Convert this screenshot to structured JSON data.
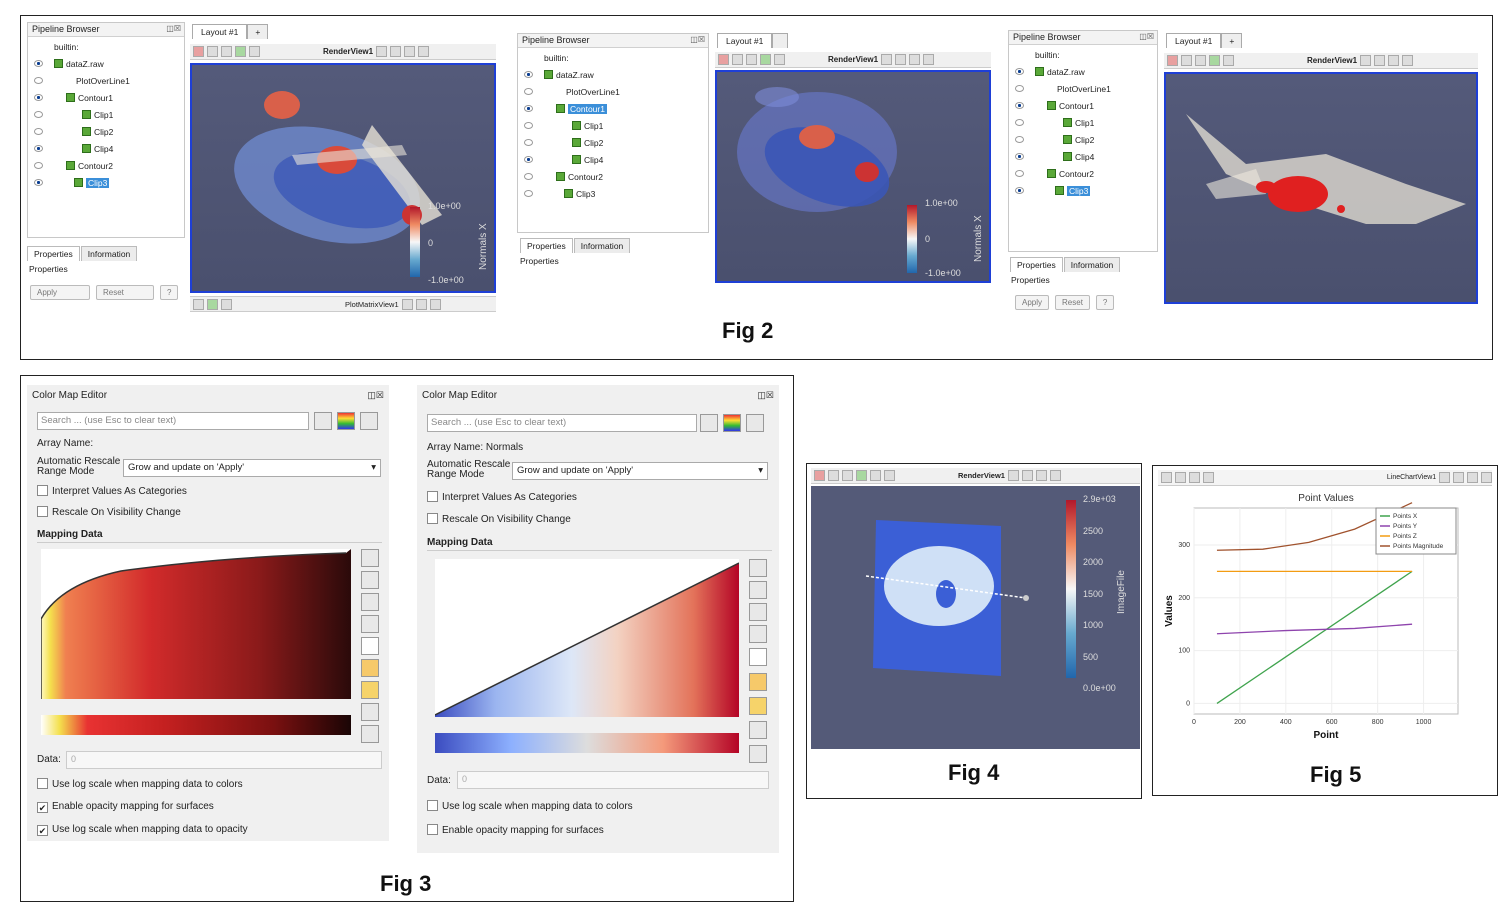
{
  "fig2": {
    "caption": "Fig 2",
    "panels": [
      {
        "pipeline_title": "Pipeline Browser",
        "tree": [
          "builtin:",
          "dataZ.raw",
          "PlotOverLine1",
          "Contour1",
          "Clip1",
          "Clip2",
          "Clip4",
          "Contour2",
          "Clip3"
        ],
        "tabs": [
          "Properties",
          "Information"
        ],
        "properties_label": "Properties",
        "apply": "Apply",
        "reset": "Reset",
        "help": "?",
        "layout_tab": "Layout #1",
        "plus": "+",
        "view_name": "RenderView1",
        "bottom_view": "PlotMatrixView1",
        "cbar_top": "1.0e+00",
        "cbar_mid": "0",
        "cbar_bot": "-1.0e+00",
        "cbar_title": "Normals X"
      },
      {
        "pipeline_title": "Pipeline Browser",
        "tree": [
          "builtin:",
          "dataZ.raw",
          "PlotOverLine1",
          "Contour1",
          "Clip1",
          "Clip2",
          "Clip4",
          "Contour2",
          "Clip3"
        ],
        "tabs": [
          "Properties",
          "Information"
        ],
        "properties_label": "Properties",
        "layout_tab": "Layout #1",
        "view_name": "RenderView1",
        "cbar_top": "1.0e+00",
        "cbar_mid": "0",
        "cbar_bot": "-1.0e+00",
        "cbar_title": "Normals X"
      },
      {
        "pipeline_title": "Pipeline Browser",
        "tree": [
          "builtin:",
          "dataZ.raw",
          "PlotOverLine1",
          "Contour1",
          "Clip1",
          "Clip2",
          "Clip4",
          "Contour2",
          "Clip3"
        ],
        "tabs": [
          "Properties",
          "Information"
        ],
        "properties_label": "Properties",
        "apply": "Apply",
        "reset": "Reset",
        "help": "?",
        "layout_tab": "Layout #1",
        "plus": "+",
        "view_name": "RenderView1"
      }
    ]
  },
  "fig3": {
    "caption": "Fig 3",
    "left": {
      "title": "Color Map Editor",
      "search_placeholder": "Search ... (use Esc to clear text)",
      "array_name": "Array Name:",
      "rescale_label_1": "Automatic Rescale",
      "rescale_label_2": "Range Mode",
      "rescale_value": "Grow and update on 'Apply'",
      "opt1": "Interpret Values As Categories",
      "opt2": "Rescale On Visibility Change",
      "mapping": "Mapping Data",
      "data_label": "Data:",
      "data_value": "0",
      "c1": "Use log scale when mapping data to colors",
      "c2": "Enable opacity mapping for surfaces",
      "c3": "Use log scale when mapping data to opacity"
    },
    "right": {
      "title": "Color Map Editor",
      "search_placeholder": "Search ... (use Esc to clear text)",
      "array_name": "Array Name: Normals",
      "rescale_label_1": "Automatic Rescale",
      "rescale_label_2": "Range Mode",
      "rescale_value": "Grow and update on 'Apply'",
      "opt1": "Interpret Values As Categories",
      "opt2": "Rescale On Visibility Change",
      "mapping": "Mapping Data",
      "data_label": "Data:",
      "data_value": "0",
      "c1": "Use log scale when mapping data to colors",
      "c2": "Enable opacity mapping for surfaces"
    }
  },
  "fig4": {
    "caption": "Fig 4",
    "view_name": "RenderView1",
    "cbar_labels": [
      "2.9e+03",
      "2500",
      "2000",
      "1500",
      "1000",
      "500",
      "0.0e+00"
    ],
    "cbar_title": "ImageFile"
  },
  "fig5": {
    "caption": "Fig 5",
    "view_name": "LineChartView1",
    "chart_data": {
      "type": "line",
      "title": "Point Values",
      "xlabel": "Point",
      "ylabel": "Values",
      "xlim": [
        0,
        1150
      ],
      "ylim": [
        -20,
        370
      ],
      "xticks": [
        "0",
        "200",
        "400",
        "600",
        "800",
        "1000"
      ],
      "yticks": [
        "0",
        "100",
        "200",
        "300",
        "400",
        "500"
      ],
      "legend_position": "top-right",
      "series": [
        {
          "name": "Points X",
          "color": "#3fa34d",
          "x": [
            100,
            950
          ],
          "y": [
            0,
            250
          ]
        },
        {
          "name": "Points Y",
          "color": "#8e44ad",
          "x": [
            100,
            400,
            700,
            950
          ],
          "y": [
            132,
            138,
            142,
            150
          ]
        },
        {
          "name": "Points Z",
          "color": "#f39c12",
          "x": [
            100,
            950
          ],
          "y": [
            250,
            250
          ]
        },
        {
          "name": "Points Magnitude",
          "color": "#a0522d",
          "x": [
            100,
            300,
            500,
            700,
            950
          ],
          "y": [
            290,
            292,
            305,
            330,
            380
          ]
        }
      ]
    }
  }
}
